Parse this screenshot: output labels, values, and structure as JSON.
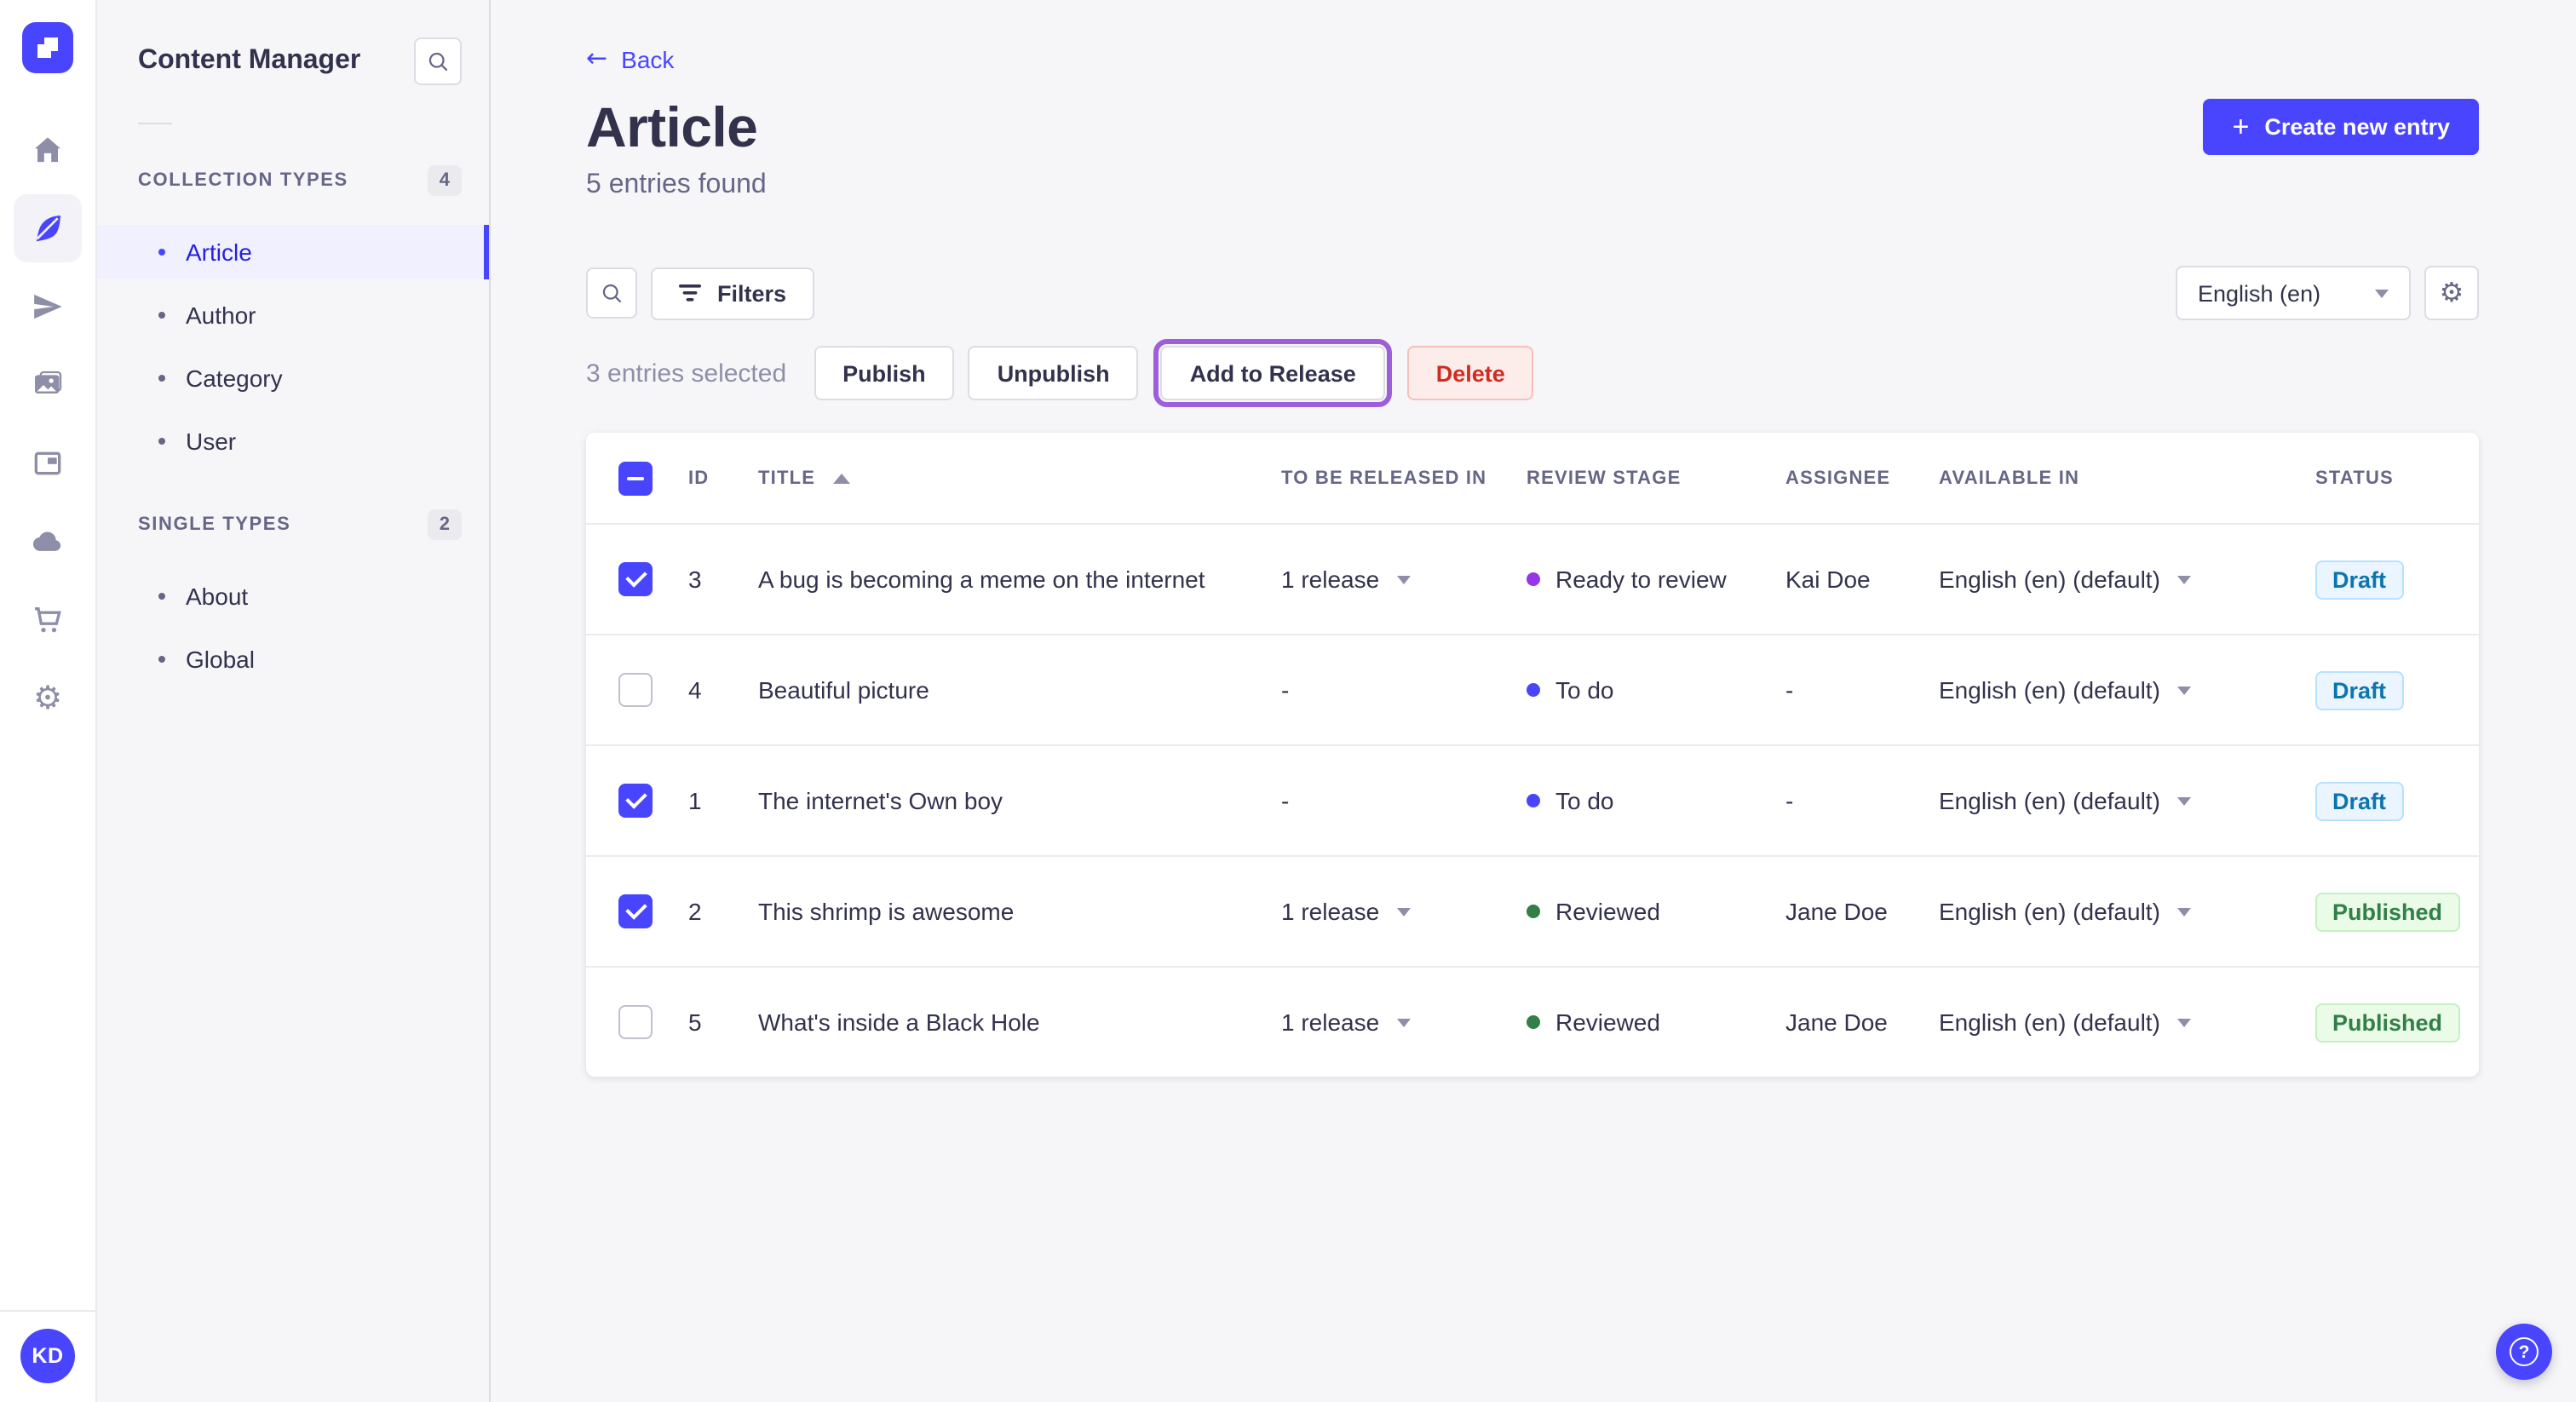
{
  "accent_color": "#4945ff",
  "rail": {
    "icons": [
      {
        "name": "home-icon"
      },
      {
        "name": "feather-icon",
        "active": true
      },
      {
        "name": "paper-plane-icon"
      },
      {
        "name": "media-icon"
      },
      {
        "name": "layout-icon"
      },
      {
        "name": "cloud-icon"
      },
      {
        "name": "cart-icon"
      },
      {
        "name": "gear-icon"
      }
    ],
    "avatar_initials": "KD"
  },
  "subnav": {
    "title": "Content Manager",
    "collection_types": {
      "label": "COLLECTION TYPES",
      "count": "4",
      "items": [
        {
          "label": "Article",
          "active": true
        },
        {
          "label": "Author"
        },
        {
          "label": "Category"
        },
        {
          "label": "User"
        }
      ]
    },
    "single_types": {
      "label": "SINGLE TYPES",
      "count": "2",
      "items": [
        {
          "label": "About"
        },
        {
          "label": "Global"
        }
      ]
    }
  },
  "header": {
    "back_label": "Back",
    "back_arrow": "←",
    "title": "Article",
    "subtitle": "5 entries found",
    "create_button": "Create new entry",
    "plus_icon": "+"
  },
  "toolbar": {
    "filters_label": "Filters",
    "locale_selected": "English (en)"
  },
  "selection": {
    "text": "3 entries selected",
    "publish_label": "Publish",
    "unpublish_label": "Unpublish",
    "add_to_release_label": "Add to Release",
    "delete_label": "Delete",
    "focus_ring_color": "#9c5fd9"
  },
  "table": {
    "headers": {
      "id": "ID",
      "title": "TITLE",
      "released": "TO BE RELEASED IN",
      "review": "REVIEW STAGE",
      "assignee": "ASSIGNEE",
      "available": "AVAILABLE IN",
      "status": "STATUS"
    },
    "sort": {
      "column": "TITLE",
      "direction": "asc"
    },
    "status_colors": {
      "draft": {
        "bg": "#eaf5ff",
        "border": "#b8e1ff",
        "text": "#0c75af"
      },
      "published": {
        "bg": "#eafbe7",
        "border": "#c6f0c2",
        "text": "#328048"
      }
    },
    "rows": [
      {
        "checked": true,
        "id": "3",
        "title": "A bug is becoming a meme on the internet",
        "released": "1 release",
        "review": "Ready to review",
        "review_color": "#9736e8",
        "assignee": "Kai Doe",
        "available": "English (en) (default)",
        "status": "Draft",
        "status_type": "draft"
      },
      {
        "checked": false,
        "id": "4",
        "title": "Beautiful picture",
        "released": "-",
        "review": "To do",
        "review_color": "#4945ff",
        "assignee": "-",
        "available": "English (en) (default)",
        "status": "Draft",
        "status_type": "draft"
      },
      {
        "checked": true,
        "id": "1",
        "title": "The internet's Own boy",
        "released": "-",
        "review": "To do",
        "review_color": "#4945ff",
        "assignee": "-",
        "available": "English (en) (default)",
        "status": "Draft",
        "status_type": "draft"
      },
      {
        "checked": true,
        "id": "2",
        "title": "This shrimp is awesome",
        "released": "1 release",
        "review": "Reviewed",
        "review_color": "#328048",
        "assignee": "Jane Doe",
        "available": "English (en) (default)",
        "status": "Published",
        "status_type": "published"
      },
      {
        "checked": false,
        "id": "5",
        "title": "What's inside a Black Hole",
        "released": "1 release",
        "review": "Reviewed",
        "review_color": "#328048",
        "assignee": "Jane Doe",
        "available": "English (en) (default)",
        "status": "Published",
        "status_type": "published"
      }
    ]
  },
  "fab": {
    "help_glyph": "?"
  }
}
